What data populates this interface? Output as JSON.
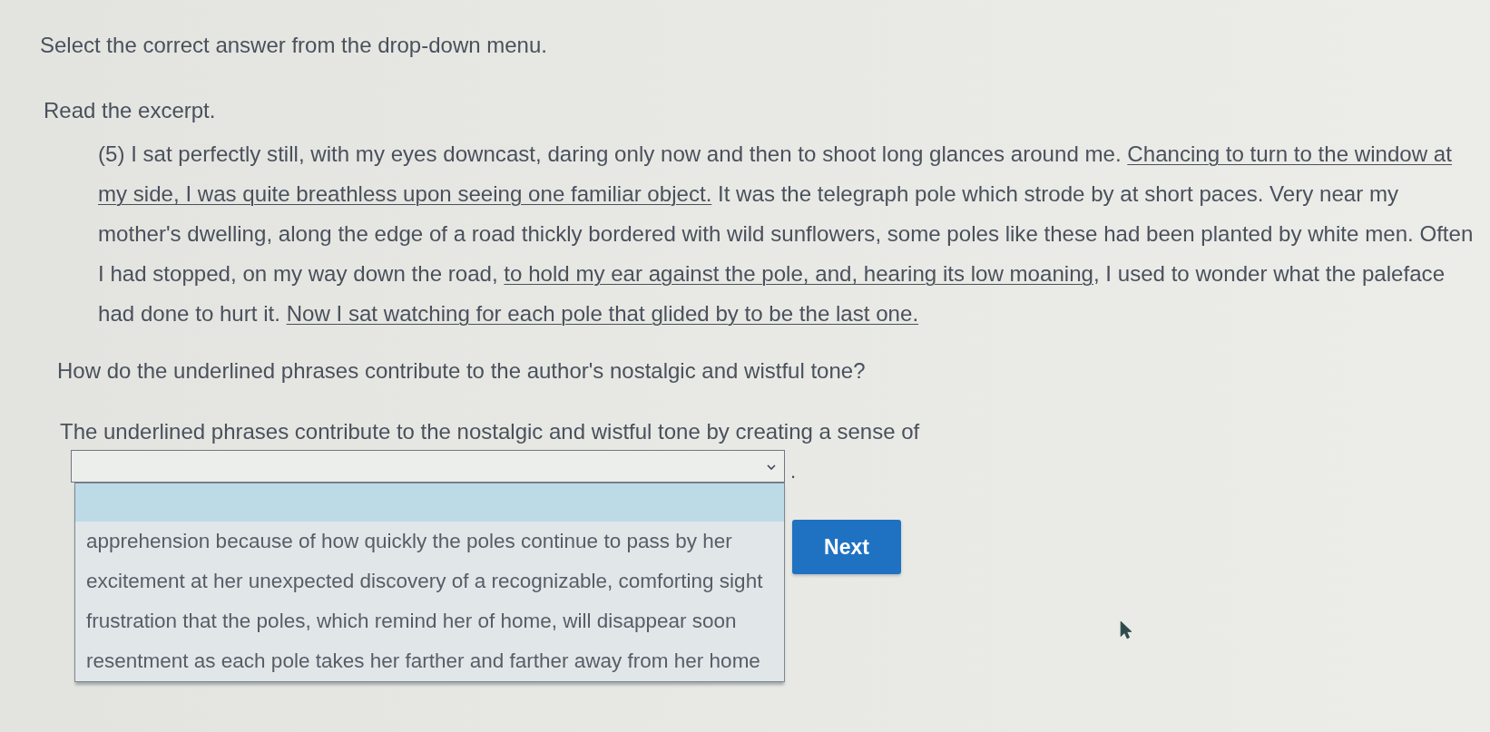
{
  "instruction": "Select the correct answer from the drop-down menu.",
  "read_prompt": "Read the excerpt.",
  "excerpt": [
    {
      "text": "(5) I sat perfectly still, with my eyes downcast, daring only now and then to shoot long glances around me. ",
      "underlined": false
    },
    {
      "text": "Chancing to turn to the window at my side, I was quite breathless upon seeing one familiar object.",
      "underlined": true
    },
    {
      "text": " It was the telegraph pole which strode by at short paces. Very near my mother's dwelling, along the edge of a road thickly bordered with wild sunflowers, some poles like these had been planted by white men. Often I had stopped, on my way down the road, ",
      "underlined": false
    },
    {
      "text": "to hold my ear against the pole, and, hearing its low moaning",
      "underlined": true
    },
    {
      "text": ", I used to wonder what the paleface had done to hurt it. ",
      "underlined": false
    },
    {
      "text": "Now I sat watching for each pole that glided by to be the last one.",
      "underlined": true
    }
  ],
  "question": "How do the underlined phrases contribute to the author's nostalgic and wistful tone?",
  "answer_sentence": "The underlined phrases contribute to the nostalgic and wistful tone by creating a sense of",
  "dropdown": {
    "expanded": true,
    "after_text": ".",
    "blank_option": {
      "highlighted": true
    },
    "options": [
      {
        "label": "apprehension because of how quickly the poles continue to pass by her",
        "highlighted": false
      },
      {
        "label": "excitement at her unexpected discovery of a recognizable, comforting sight",
        "highlighted": false
      },
      {
        "label": "frustration that the poles, which remind her of home, will disappear soon",
        "highlighted": false
      },
      {
        "label": "resentment as each pole takes her farther and farther away from her home",
        "highlighted": false
      }
    ]
  },
  "next_button": {
    "label": "Next"
  }
}
